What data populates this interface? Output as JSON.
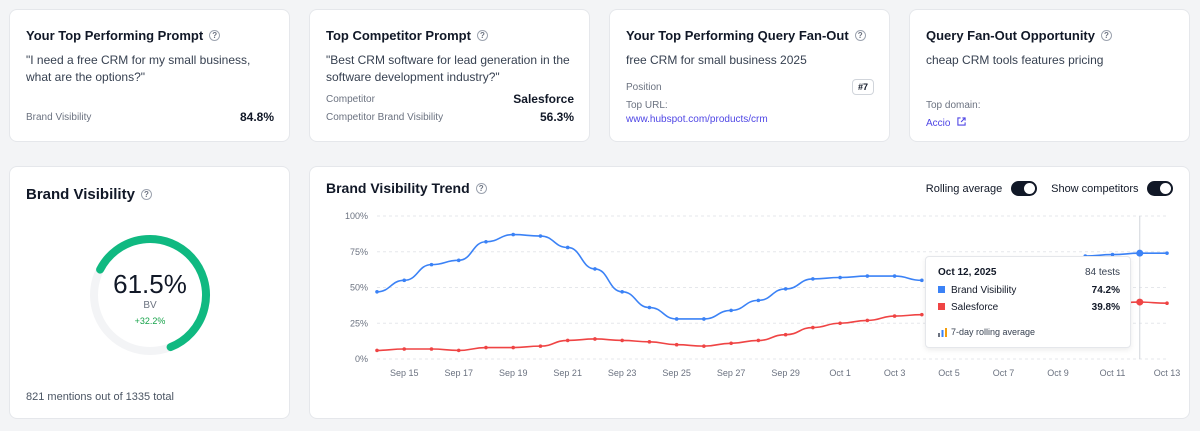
{
  "cards": {
    "top_prompt": {
      "title": "Your Top Performing Prompt",
      "text": "\"I need a free CRM for my small business, what are the options?\"",
      "metric_label": "Brand Visibility",
      "metric_value": "84.8%"
    },
    "competitor_prompt": {
      "title": "Top Competitor Prompt",
      "text": "\"Best CRM software for lead generation in the software development industry?\"",
      "competitor_label": "Competitor",
      "competitor_value": "Salesforce",
      "bv_label": "Competitor Brand Visibility",
      "bv_value": "56.3%"
    },
    "fanout": {
      "title": "Your Top Performing Query Fan-Out",
      "text": "free CRM for small business 2025",
      "position_label": "Position",
      "position_value": "#7",
      "url_label": "Top URL:",
      "url_value": "www.hubspot.com/products/crm"
    },
    "opportunity": {
      "title": "Query Fan-Out Opportunity",
      "text": "cheap CRM tools features pricing",
      "domain_label": "Top domain:",
      "domain_value": "Accio"
    }
  },
  "visibility": {
    "title": "Brand Visibility",
    "value": "61.5%",
    "fraction": 0.615,
    "sub": "BV",
    "change": "+32.2%",
    "footer": "821 mentions out of 1335 total",
    "accent": "#10b981"
  },
  "trend": {
    "title": "Brand Visibility Trend",
    "rolling_label": "Rolling average",
    "competitors_label": "Show competitors",
    "tooltip": {
      "date": "Oct 12, 2025",
      "tests": "84 tests",
      "rows": [
        {
          "name": "Brand Visibility",
          "value": "74.2%",
          "color": "#3b82f6"
        },
        {
          "name": "Salesforce",
          "value": "39.8%",
          "color": "#ef4444"
        }
      ],
      "note": "7-day rolling average"
    }
  },
  "chart_data": {
    "type": "line",
    "x_ticks": [
      "Sep 15",
      "Sep 17",
      "Sep 19",
      "Sep 21",
      "Sep 23",
      "Sep 25",
      "Sep 27",
      "Sep 29",
      "Oct 1",
      "Oct 3",
      "Oct 5",
      "Oct 7",
      "Oct 9",
      "Oct 11",
      "Oct 13"
    ],
    "y_ticks": [
      "0%",
      "25%",
      "50%",
      "75%",
      "100%"
    ],
    "ylim": [
      0,
      100
    ],
    "grid": true,
    "x_dates": [
      "Sep 14",
      "Sep 15",
      "Sep 16",
      "Sep 17",
      "Sep 18",
      "Sep 19",
      "Sep 20",
      "Sep 21",
      "Sep 22",
      "Sep 23",
      "Sep 24",
      "Sep 25",
      "Sep 26",
      "Sep 27",
      "Sep 28",
      "Sep 29",
      "Sep 30",
      "Oct 1",
      "Oct 2",
      "Oct 3",
      "Oct 4",
      "Oct 5",
      "Oct 6",
      "Oct 7",
      "Oct 8",
      "Oct 9",
      "Oct 10",
      "Oct 11",
      "Oct 12",
      "Oct 13"
    ],
    "series": [
      {
        "color": "#3b82f6",
        "values": [
          47,
          55,
          66,
          69,
          82,
          87,
          86,
          78,
          63,
          47,
          36,
          28,
          28,
          34,
          41,
          49,
          56,
          57,
          58,
          58,
          55,
          null,
          null,
          null,
          null,
          null,
          72,
          73,
          74,
          74
        ]
      },
      {
        "color": "#ef4444",
        "values": [
          6,
          7,
          7,
          6,
          8,
          8,
          9,
          13,
          14,
          13,
          12,
          10,
          9,
          11,
          13,
          17,
          22,
          25,
          27,
          30,
          31,
          null,
          null,
          null,
          null,
          null,
          null,
          39,
          39.8,
          39
        ]
      }
    ]
  }
}
